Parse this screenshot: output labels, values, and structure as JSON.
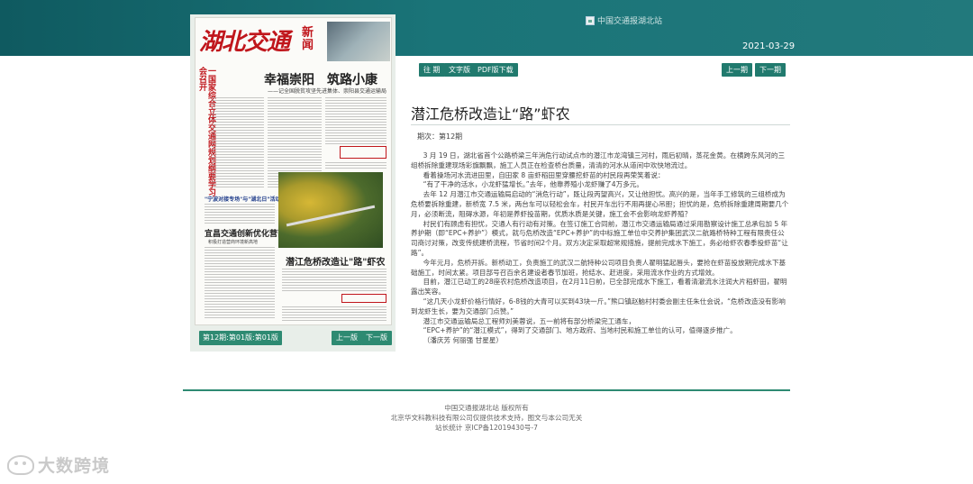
{
  "header": {
    "banner_alt": "中国交通报湖北站",
    "date": "2021-03-29"
  },
  "paper": {
    "masthead": "湖北交通",
    "masthead_news": "新闻",
    "red_column": "一国家综合立体交通网规划纲要学习会召开",
    "headline_main": "幸福崇阳　筑路小康",
    "headline_sub": "——记全国脱贫攻坚先进集体、崇阳县交通运输局",
    "headline_blue": "\"宁波对接专场\"与\"湖北日\"活动",
    "headline_mid": "宜昌交通创新优化营商环境",
    "headline_mid_sub": "积极打造营商环境新高地",
    "headline_bottom": "潜江危桥改造让\"路\"虾农"
  },
  "pager": {
    "page_info": "第12期:第01版:第01版",
    "prev": "上一版",
    "next": "下一版"
  },
  "toolbar": {
    "past": "往 期",
    "text_version": "文字版",
    "pdf_download": "PDF版下载",
    "prev_issue": "上一期",
    "next_issue": "下一期"
  },
  "article": {
    "title": "潜江危桥改造让“路”虾农",
    "issue": "期次：第12期",
    "paragraphs": [
      "3 月 19 日，湖北省首个公路桥梁三年消危行动试点市的潜江市龙湾镇三河村，雨后初晴，蒸花金黄。在横跨东风河的三组桥拆除重建现场彩旗飘飘，施工人员正在检查桥台质量，清清的河水从道间中欢快地流过。",
      "看着操场河水流进田里，自田家 8 亩虾稻田里穿腰挖虾苗的村民段再荣笑着说：",
      "“有了干净的活水，小龙虾猛增长。”去年，他靠养殖小龙虾赚了4万多元。",
      "去年 12 月潜江市交通运输局启动的“消危行动”，既让段丙望高兴，又让他担忧。高兴的是，当年手工修筑的三组桥成为危桥要拆除重建，新桥宽 7.5 米，两台车可以轻松会车，村民开车出行不用再提心吊胆；担忧的是，危桥拆除重建周期要几个月，必须断流，阻碍水源，年初是养虾投苗期，优质水质是关键，施工会不会影响龙虾养殖？",
      "村民们有顾虑有担忧，交通人有行动有对策。在签订施工合同前，潜江市交通运输局通过采用勘察设计施工总承包加 5 年养护期（即“EPC+养护”）模式，就与危桥改造“EPC+养护”的中标施工单位中交养护集团武汉二航路桥特种工程有限责任公司商讨对策，改变传统建桥流程，节省时间2个月。双方决定采取超常规措施，提前完成水下施工，务必给虾农春季投虾苗“让路”。",
      "今年元月，危桥开拆。新桥动工，负责施工的武汉二航特种公司项目负责人翟明猛起唇头，要抢在虾苗投放期完成水下基础施工，时间太紧。项目部号召百余名建设者春节加班，抢结水、赶进度，采用流水作业的方式增效。",
      "目前，潜江已动工的28座农村危桥改造项目，在2月11日前，已全部完成水下施工，看着清澈流水注润大片稻虾田，翟明露出笑容。",
      "“这几天小龙虾价格行情好，6-8钱的大青可以买到43块一斤。”熊口镇赵脑村村委会副主任朱仕会说，“危桥改造没有影响到龙虾生长，要为交通部门点赞。”",
      "潜江市交通运输局总工程师刘美蓉说，五一前将有部分桥梁完工通车，",
      "“EPC+养护”的“潜江模式”，得到了交通部门、地方政府、当地村民和施工单位的认可，值得逐步推广。",
      "（潘庆芳  何丽强  甘星星）"
    ]
  },
  "footer": {
    "line1": "中国交通报湖北站 版权所有",
    "line2": "北京华文科教科技有限公司仅提供技术支持，图文与本公司无关",
    "line3": "站长统计  京ICP备12019430号-7"
  },
  "watermark": {
    "text": "大数跨境"
  }
}
